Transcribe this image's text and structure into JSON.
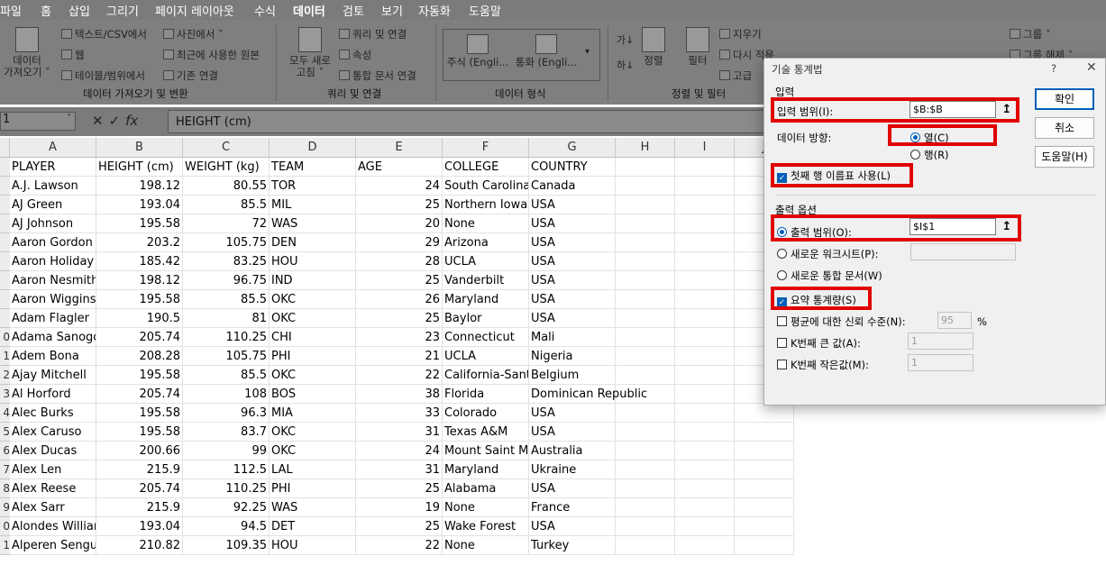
{
  "menu": [
    "파일",
    "홈",
    "삽입",
    "그리기",
    "페이지 레이아웃",
    "수식",
    "데이터",
    "검토",
    "보기",
    "자동화",
    "도움말"
  ],
  "ribbon": {
    "get_data_1": "데이터",
    "get_data_2": "가져오기 ˅",
    "text_csv": "텍스트/CSV에서",
    "web": "웹",
    "table_range": "테이블/범위에서",
    "from_photo": "사진에서 ˅",
    "recent_sources": "최근에 사용한 원본",
    "existing_conn": "기존 연결",
    "group_get": "데이터 가져오기 및 변환",
    "refresh_1": "모두 새로",
    "refresh_2": "고침 ˅",
    "queries_conn": "쿼리 및 연결",
    "properties": "속성",
    "workbook_links": "통합 문서 연결",
    "group_queries": "쿼리 및 연결",
    "stocks": "주식 (Engli...",
    "currency": "통화 (Engli...",
    "group_types": "데이터 형식",
    "sort_az": "가↓",
    "sort_za": "하↓",
    "sort": "정렬",
    "filter": "필터",
    "clear": "지우기",
    "reapply": "다시 적용",
    "advanced": "고급",
    "group_sort": "정렬 및 필터",
    "group": "그룹 ˅",
    "ungroup": "그룹 해제 ˅"
  },
  "formula_bar": {
    "name_box": "1",
    "fx": "fx",
    "content": "HEIGHT (cm)"
  },
  "columns": [
    "A",
    "B",
    "C",
    "D",
    "E",
    "F",
    "G",
    "H",
    "I",
    "J"
  ],
  "rows": [
    {
      "r": "",
      "c": [
        "PLAYER",
        "HEIGHT (cm)",
        "WEIGHT (kg)",
        "TEAM",
        "AGE",
        "COLLEGE",
        "COUNTRY"
      ]
    },
    {
      "r": "",
      "c": [
        "A.J. Lawson",
        "198.12",
        "80.55",
        "TOR",
        "24",
        "South Carolina",
        "Canada"
      ]
    },
    {
      "r": "",
      "c": [
        "AJ Green",
        "193.04",
        "85.5",
        "MIL",
        "25",
        "Northern Iowa",
        "USA"
      ]
    },
    {
      "r": "",
      "c": [
        "AJ Johnson",
        "195.58",
        "72",
        "WAS",
        "20",
        "None",
        "USA"
      ]
    },
    {
      "r": "",
      "c": [
        "Aaron Gordon",
        "203.2",
        "105.75",
        "DEN",
        "29",
        "Arizona",
        "USA"
      ]
    },
    {
      "r": "",
      "c": [
        "Aaron Holiday",
        "185.42",
        "83.25",
        "HOU",
        "28",
        "UCLA",
        "USA"
      ]
    },
    {
      "r": "",
      "c": [
        "Aaron Nesmith",
        "198.12",
        "96.75",
        "IND",
        "25",
        "Vanderbilt",
        "USA"
      ]
    },
    {
      "r": "",
      "c": [
        "Aaron Wiggins",
        "195.58",
        "85.5",
        "OKC",
        "26",
        "Maryland",
        "USA"
      ]
    },
    {
      "r": "",
      "c": [
        "Adam Flagler",
        "190.5",
        "81",
        "OKC",
        "25",
        "Baylor",
        "USA"
      ]
    },
    {
      "r": "0",
      "c": [
        "Adama Sanogo",
        "205.74",
        "110.25",
        "CHI",
        "23",
        "Connecticut",
        "Mali"
      ]
    },
    {
      "r": "1",
      "c": [
        "Adem Bona",
        "208.28",
        "105.75",
        "PHI",
        "21",
        "UCLA",
        "Nigeria"
      ]
    },
    {
      "r": "2",
      "c": [
        "Ajay Mitchell",
        "195.58",
        "85.5",
        "OKC",
        "22",
        "California-Santa",
        "Belgium"
      ]
    },
    {
      "r": "3",
      "c": [
        "Al Horford",
        "205.74",
        "108",
        "BOS",
        "38",
        "Florida",
        "Dominican Republic"
      ]
    },
    {
      "r": "4",
      "c": [
        "Alec Burks",
        "195.58",
        "96.3",
        "MIA",
        "33",
        "Colorado",
        "USA"
      ]
    },
    {
      "r": "5",
      "c": [
        "Alex Caruso",
        "195.58",
        "83.7",
        "OKC",
        "31",
        "Texas A&M",
        "USA"
      ]
    },
    {
      "r": "6",
      "c": [
        "Alex Ducas",
        "200.66",
        "99",
        "OKC",
        "24",
        "Mount Saint Ma",
        "Australia"
      ]
    },
    {
      "r": "7",
      "c": [
        "Alex Len",
        "215.9",
        "112.5",
        "LAL",
        "31",
        "Maryland",
        "Ukraine"
      ]
    },
    {
      "r": "8",
      "c": [
        "Alex Reese",
        "205.74",
        "110.25",
        "PHI",
        "25",
        "Alabama",
        "USA"
      ]
    },
    {
      "r": "9",
      "c": [
        "Alex Sarr",
        "215.9",
        "92.25",
        "WAS",
        "19",
        "None",
        "France"
      ]
    },
    {
      "r": "0",
      "c": [
        "Alondes William",
        "193.04",
        "94.5",
        "DET",
        "25",
        "Wake Forest",
        "USA"
      ]
    },
    {
      "r": "1",
      "c": [
        "Alperen Sengun",
        "210.82",
        "109.35",
        "HOU",
        "22",
        "None",
        "Turkey"
      ]
    }
  ],
  "dialog": {
    "title": "기술 통계법",
    "help": "?",
    "close": "✕",
    "section_input": "입력",
    "input_range_label": "입력 범위(I):",
    "input_range_value": "$B:$B",
    "grouped_by_label": "데이터 방향:",
    "columns_label": "열(C)",
    "rows_label": "행(R)",
    "labels_first_row": "첫째 행 이름표 사용(L)",
    "section_output": "출력 옵션",
    "output_range_label": "출력 범위(O):",
    "output_range_value": "$I$1",
    "new_sheet_label": "새로운 워크시트(P):",
    "new_workbook_label": "새로운 통합 문서(W)",
    "summary_stats": "요약 통계량(S)",
    "confidence_label": "평균에 대한 신뢰 수준(N):",
    "confidence_value": "95",
    "percent": "%",
    "kth_largest_label": "K번째 큰 값(A):",
    "kth_largest_value": "1",
    "kth_smallest_label": "K번째 작은값(M):",
    "kth_smallest_value": "1",
    "ok": "확인",
    "cancel": "취소",
    "help_btn": "도움말(H)",
    "upload_arrow": "↥"
  },
  "colors": {
    "highlight": "#e00000",
    "accent": "#005fb8",
    "dim": "#7b7b7b"
  }
}
